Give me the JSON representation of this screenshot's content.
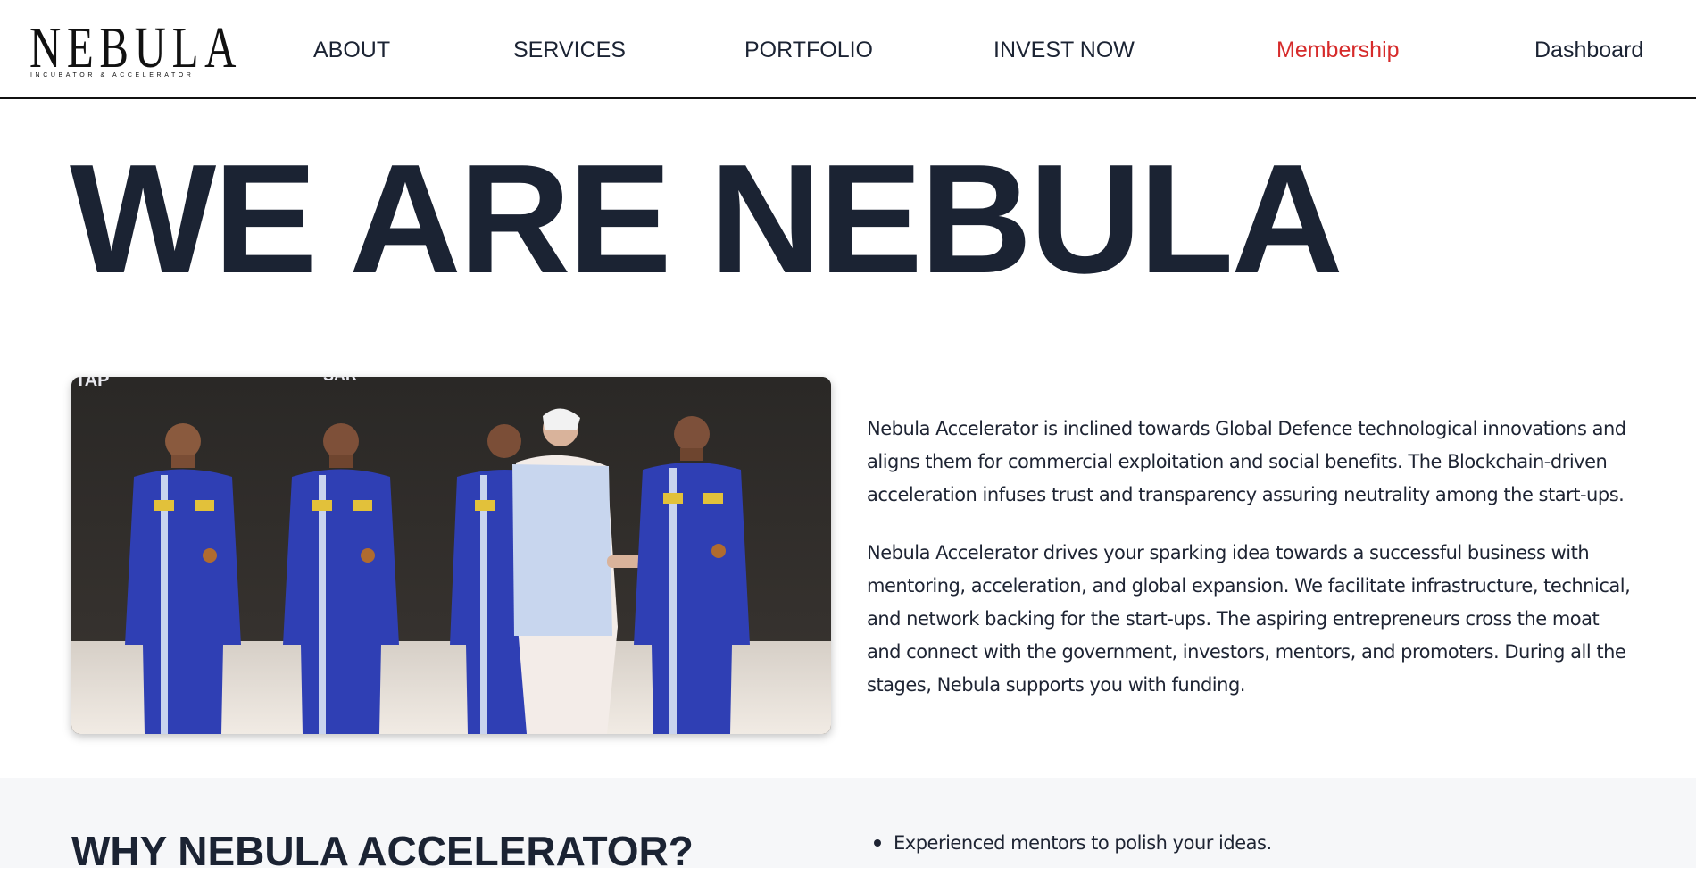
{
  "header": {
    "logo": {
      "word": "NEBULA",
      "tagline": "INCUBATOR & ACCELERATOR"
    },
    "nav": [
      {
        "label": "ABOUT"
      },
      {
        "label": "SERVICES"
      },
      {
        "label": "PORTFOLIO"
      },
      {
        "label": "INVEST NOW"
      },
      {
        "label": "Membership",
        "color": "#d62b2b"
      },
      {
        "label": "Dashboard"
      }
    ]
  },
  "hero": {
    "title": "WE ARE NEBULA"
  },
  "about": {
    "paragraphs": [
      "Nebula Accelerator is inclined towards Global Defence technological innovations and aligns them for commercial exploitation and social benefits. The Blockchain-driven acceleration infuses trust and transparency assuring neutrality among the start-ups.",
      "Nebula Accelerator drives your sparking idea towards a successful business with mentoring, acceleration, and global expansion. We facilitate infrastructure, technical, and network backing for the start-ups. The aspiring entrepreneurs cross the moat and connect with the government, investors, mentors, and promoters. During all the stages, Nebula supports you with funding."
    ],
    "photo_backdrop_text": [
      "TAP",
      "SAR"
    ]
  },
  "why": {
    "title": "WHY NEBULA ACCELERATOR?",
    "points": [
      "Experienced mentors to polish your ideas."
    ]
  },
  "colors": {
    "text_dark": "#1b2333",
    "accent_red": "#d62b2b",
    "flight_suit_blue": "#2f3fb4",
    "section_bg": "#f6f7f9"
  }
}
